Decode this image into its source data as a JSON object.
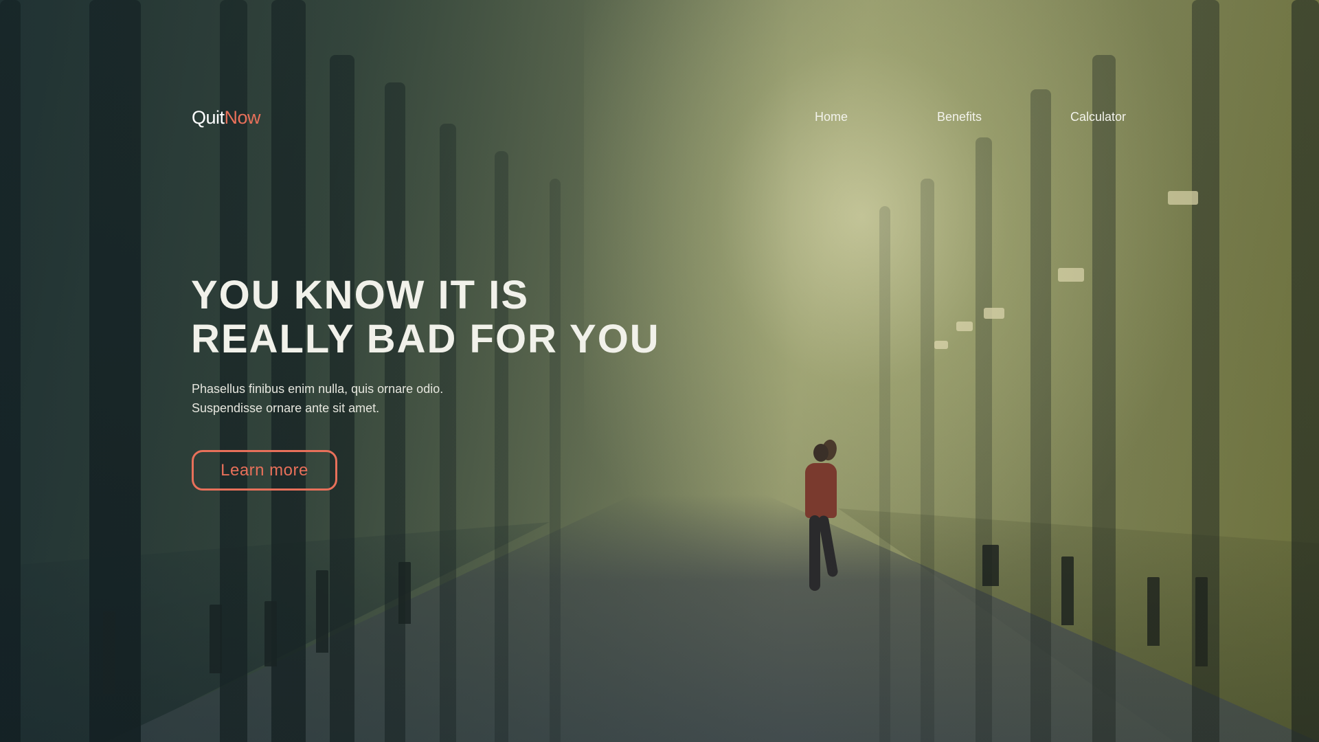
{
  "header": {
    "logo_part1": "Quit",
    "logo_part2": "Now",
    "nav": [
      {
        "label": "Home"
      },
      {
        "label": "Benefits"
      },
      {
        "label": "Calculator"
      }
    ]
  },
  "hero": {
    "headline_line1": "YOU KNOW IT IS",
    "headline_line2": "REALLY BAD FOR YOU",
    "subtitle_line1": "Phasellus finibus enim nulla, quis ornare odio.",
    "subtitle_line2": "Suspendisse ornare ante sit amet.",
    "cta_label": "Learn more"
  },
  "colors": {
    "accent": "#e8705a",
    "text_light": "#f1f1ea"
  }
}
